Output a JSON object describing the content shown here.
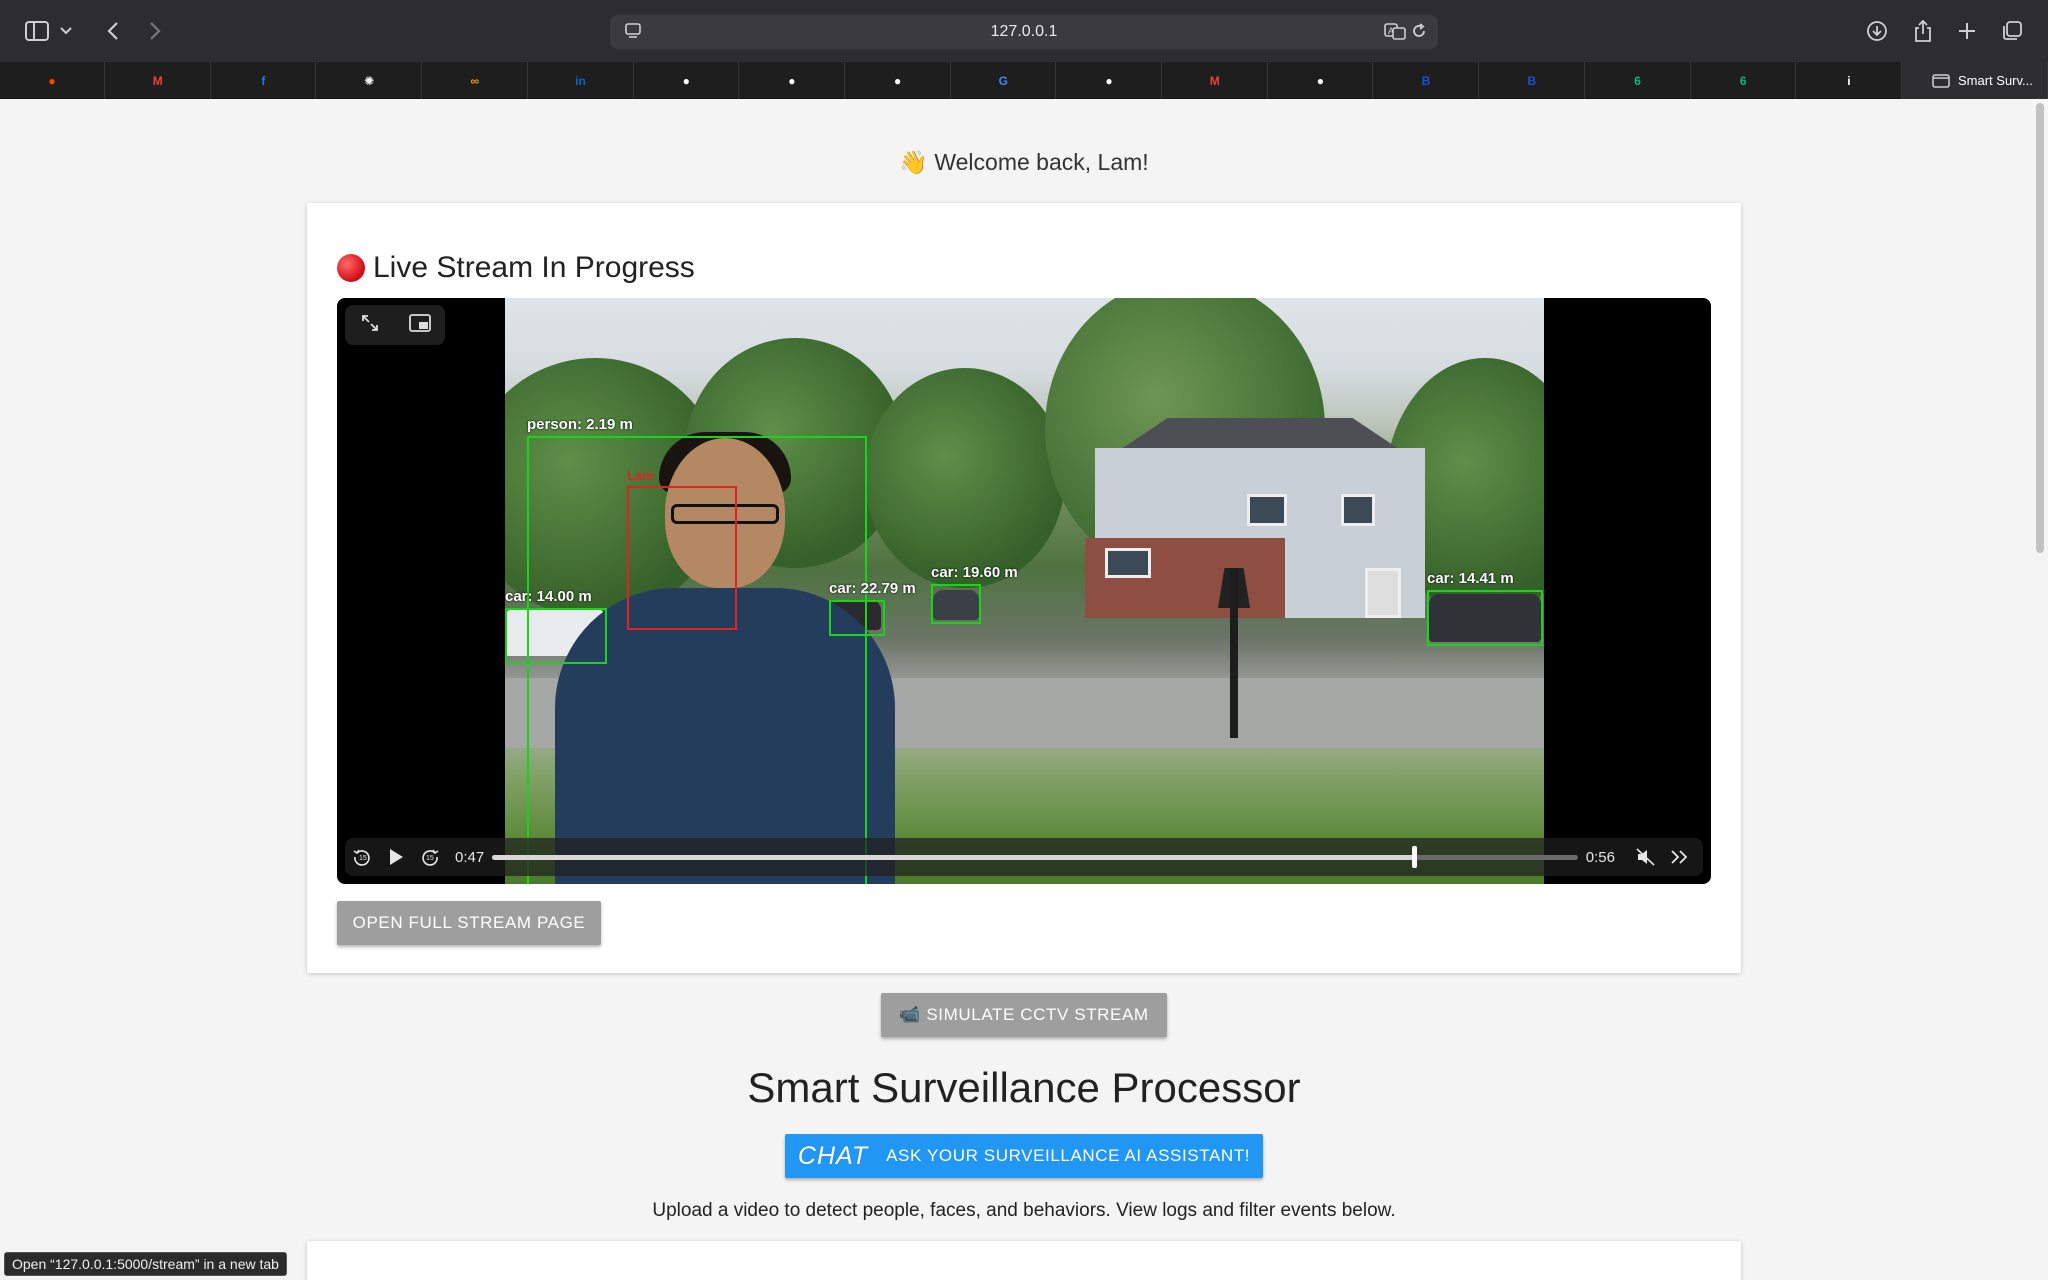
{
  "browser": {
    "url": "127.0.0.1",
    "tabs": [
      {
        "icon": "reddit-icon",
        "color": "#ff4500",
        "glyph": "●"
      },
      {
        "icon": "gmail-icon",
        "color": "#ea4335",
        "glyph": "M"
      },
      {
        "icon": "facebook-icon",
        "color": "#1877f2",
        "glyph": "f"
      },
      {
        "icon": "openai-icon",
        "color": "#ffffff",
        "glyph": "✺"
      },
      {
        "icon": "infinity-icon",
        "color": "#f59e0b",
        "glyph": "∞"
      },
      {
        "icon": "linkedin-icon",
        "color": "#0a66c2",
        "glyph": "in"
      },
      {
        "icon": "github-icon",
        "color": "#ffffff",
        "glyph": "●"
      },
      {
        "icon": "github-icon",
        "color": "#ffffff",
        "glyph": "●"
      },
      {
        "icon": "github-icon",
        "color": "#ffffff",
        "glyph": "●"
      },
      {
        "icon": "google-icon",
        "color": "#4285f4",
        "glyph": "G"
      },
      {
        "icon": "github-icon",
        "color": "#ffffff",
        "glyph": "●"
      },
      {
        "icon": "gmail-icon",
        "color": "#ea4335",
        "glyph": "M"
      },
      {
        "icon": "github-icon",
        "color": "#ffffff",
        "glyph": "●"
      },
      {
        "icon": "b-icon",
        "color": "#1d4ed8",
        "glyph": "B"
      },
      {
        "icon": "b-icon",
        "color": "#1d4ed8",
        "glyph": "B"
      },
      {
        "icon": "spiral-icon",
        "color": "#10b981",
        "glyph": "6"
      },
      {
        "icon": "spiral-icon",
        "color": "#10b981",
        "glyph": "6"
      },
      {
        "icon": "info-icon",
        "color": "#ffffff",
        "glyph": "i"
      }
    ],
    "active_tab": "Smart Surv...",
    "status_link": "Open “127.0.0.1:5000/stream” in a new tab"
  },
  "page": {
    "welcome": "👋 Welcome back, Lam!",
    "stream_title": "Live Stream In Progress",
    "video": {
      "current_time": "0:47",
      "duration": "0:56",
      "progress": 0.849,
      "detections": [
        {
          "label": "person: 2.19 m"
        },
        {
          "label": "Lam"
        },
        {
          "label": "car: 14.00 m"
        },
        {
          "label": "car: 22.79 m"
        },
        {
          "label": "car: 19.60 m"
        },
        {
          "label": "car: 14.41 m"
        }
      ]
    },
    "open_stream_button": "Open Full Stream Page",
    "simulate_button": "📹 Simulate CCTV Stream",
    "main_title": "Smart Surveillance Processor",
    "chat_button": {
      "chat": "CHAT",
      "label": "Ask Your Surveillance AI Assistant!"
    },
    "subtext": "Upload a video to detect people, faces, and behaviors. View logs and filter events below."
  }
}
